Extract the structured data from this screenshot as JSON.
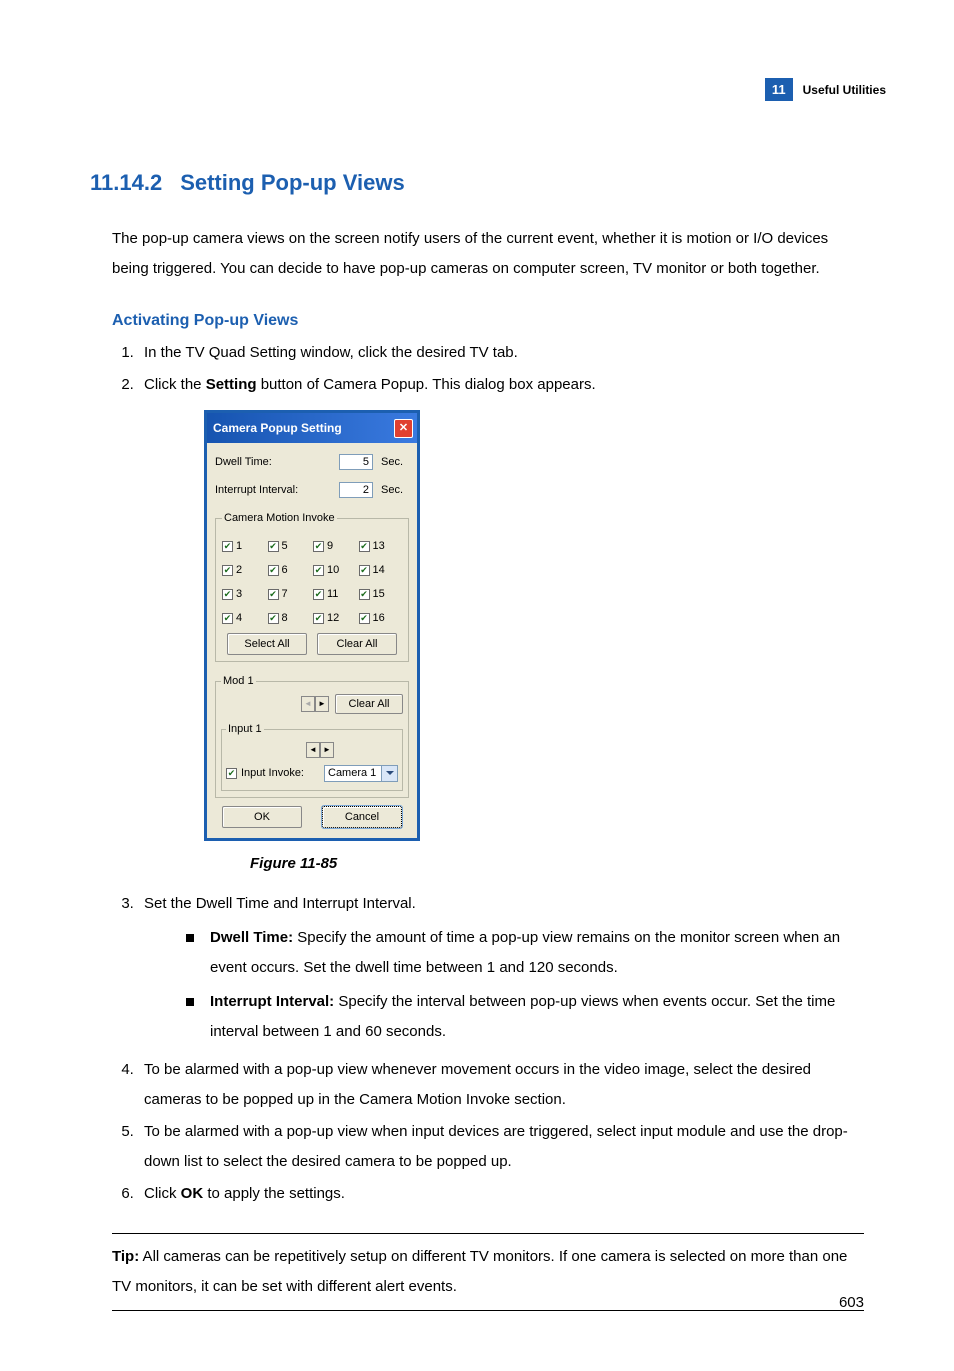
{
  "header": {
    "chapter_number": "11",
    "chapter_title": "Useful Utilities"
  },
  "section": {
    "number": "11.14.2",
    "title": "Setting Pop-up Views",
    "intro": "The pop-up camera views on the screen notify users of the current event, whether it is motion or I/O devices being triggered. You can decide to have pop-up cameras on computer screen, TV monitor or both together."
  },
  "subheading": "Activating Pop-up Views",
  "steps": {
    "s1": "In the TV Quad Setting window, click the desired TV tab.",
    "s2_a": "Click the ",
    "s2_b": "Setting",
    "s2_c": " button of Camera Popup. This dialog box appears.",
    "s3": "Set the Dwell Time and Interrupt Interval.",
    "s3_b1_a": "Dwell Time:",
    "s3_b1_b": " Specify the amount of time a pop-up view remains on the monitor screen when an event occurs. Set the dwell time between 1 and 120 seconds.",
    "s3_b2_a": "Interrupt Interval:",
    "s3_b2_b": " Specify the interval between pop-up views when events occur. Set the time interval between 1 and 60 seconds.",
    "s4": "To be alarmed with a pop-up view whenever movement occurs in the video image, select the desired cameras to be popped up in the Camera Motion Invoke section.",
    "s5": "To be alarmed with a pop-up view when input devices are triggered, select input module and use the drop-down list to select the desired camera to be popped up.",
    "s6_a": "Click ",
    "s6_b": "OK",
    "s6_c": " to apply the settings."
  },
  "figure_caption": "Figure 11-85",
  "tip_a": "Tip:",
  "tip_b": " All cameras can be repetitively setup on different TV monitors. If one camera is selected on more than one TV monitors, it can be set with different alert events.",
  "page_number": "603",
  "dialog": {
    "title": "Camera Popup Setting",
    "dwell_label": "Dwell Time:",
    "dwell_value": "5",
    "interrupt_label": "Interrupt Interval:",
    "interrupt_value": "2",
    "sec": "Sec.",
    "cmi_legend": "Camera Motion Invoke",
    "cams": [
      "1",
      "2",
      "3",
      "4",
      "5",
      "6",
      "7",
      "8",
      "9",
      "10",
      "11",
      "12",
      "13",
      "14",
      "15",
      "16"
    ],
    "select_all": "Select All",
    "clear_all": "Clear All",
    "mod_legend": "Mod 1",
    "input_legend": "Input 1",
    "input_invoke": "Input Invoke:",
    "camera_selected": "Camera 1",
    "ok": "OK",
    "cancel": "Cancel"
  }
}
